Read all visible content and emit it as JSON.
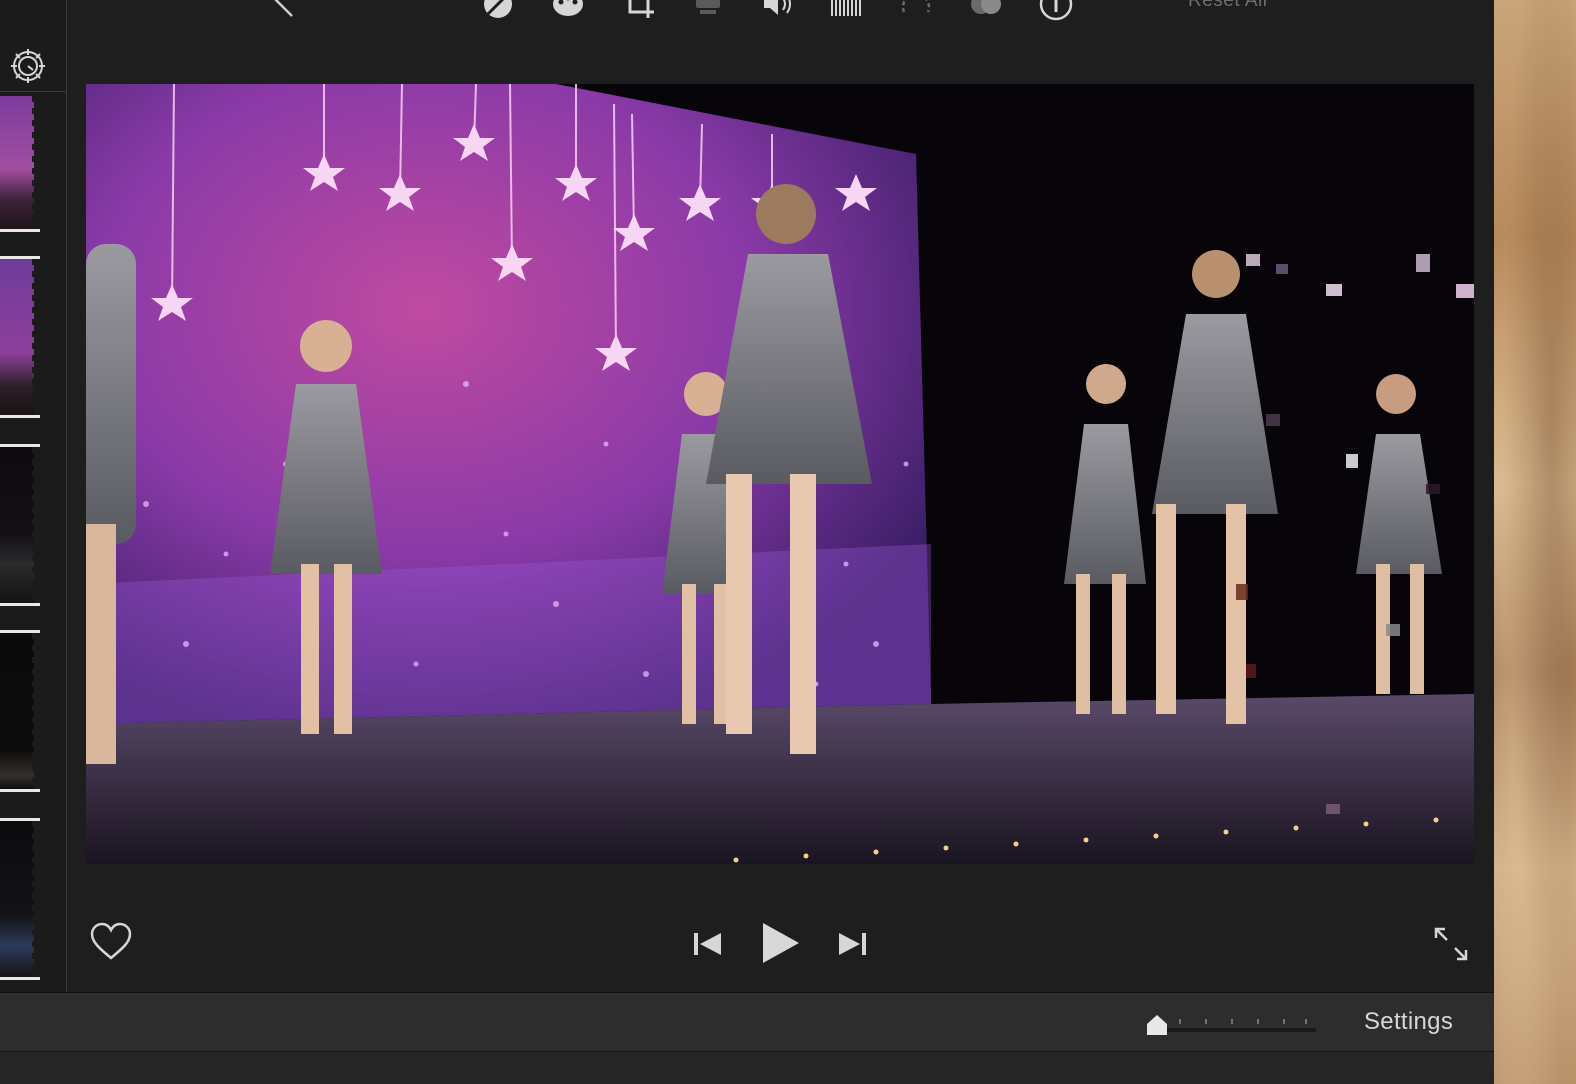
{
  "toolbar": {
    "tools": [
      {
        "name": "magic-wand-icon"
      },
      {
        "name": "color-balance-icon"
      },
      {
        "name": "color-correction-icon"
      },
      {
        "name": "crop-icon"
      },
      {
        "name": "stabilization-icon"
      },
      {
        "name": "volume-icon"
      },
      {
        "name": "noise-reduction-icon"
      },
      {
        "name": "speed-icon"
      },
      {
        "name": "clip-filter-icon"
      },
      {
        "name": "info-icon"
      }
    ],
    "reset_all_label": "Reset All"
  },
  "playback": {
    "favorite_icon": "heart-icon",
    "prev_icon": "skip-back-icon",
    "play_icon": "play-icon",
    "next_icon": "skip-forward-icon",
    "fullscreen_icon": "expand-icon"
  },
  "bottom_bar": {
    "zoom_level": 0,
    "settings_label": "Settings"
  },
  "colors": {
    "background": "#1e1e1e",
    "bottom_bar": "#2d2d2d",
    "accent_text": "#d7d7d7"
  }
}
